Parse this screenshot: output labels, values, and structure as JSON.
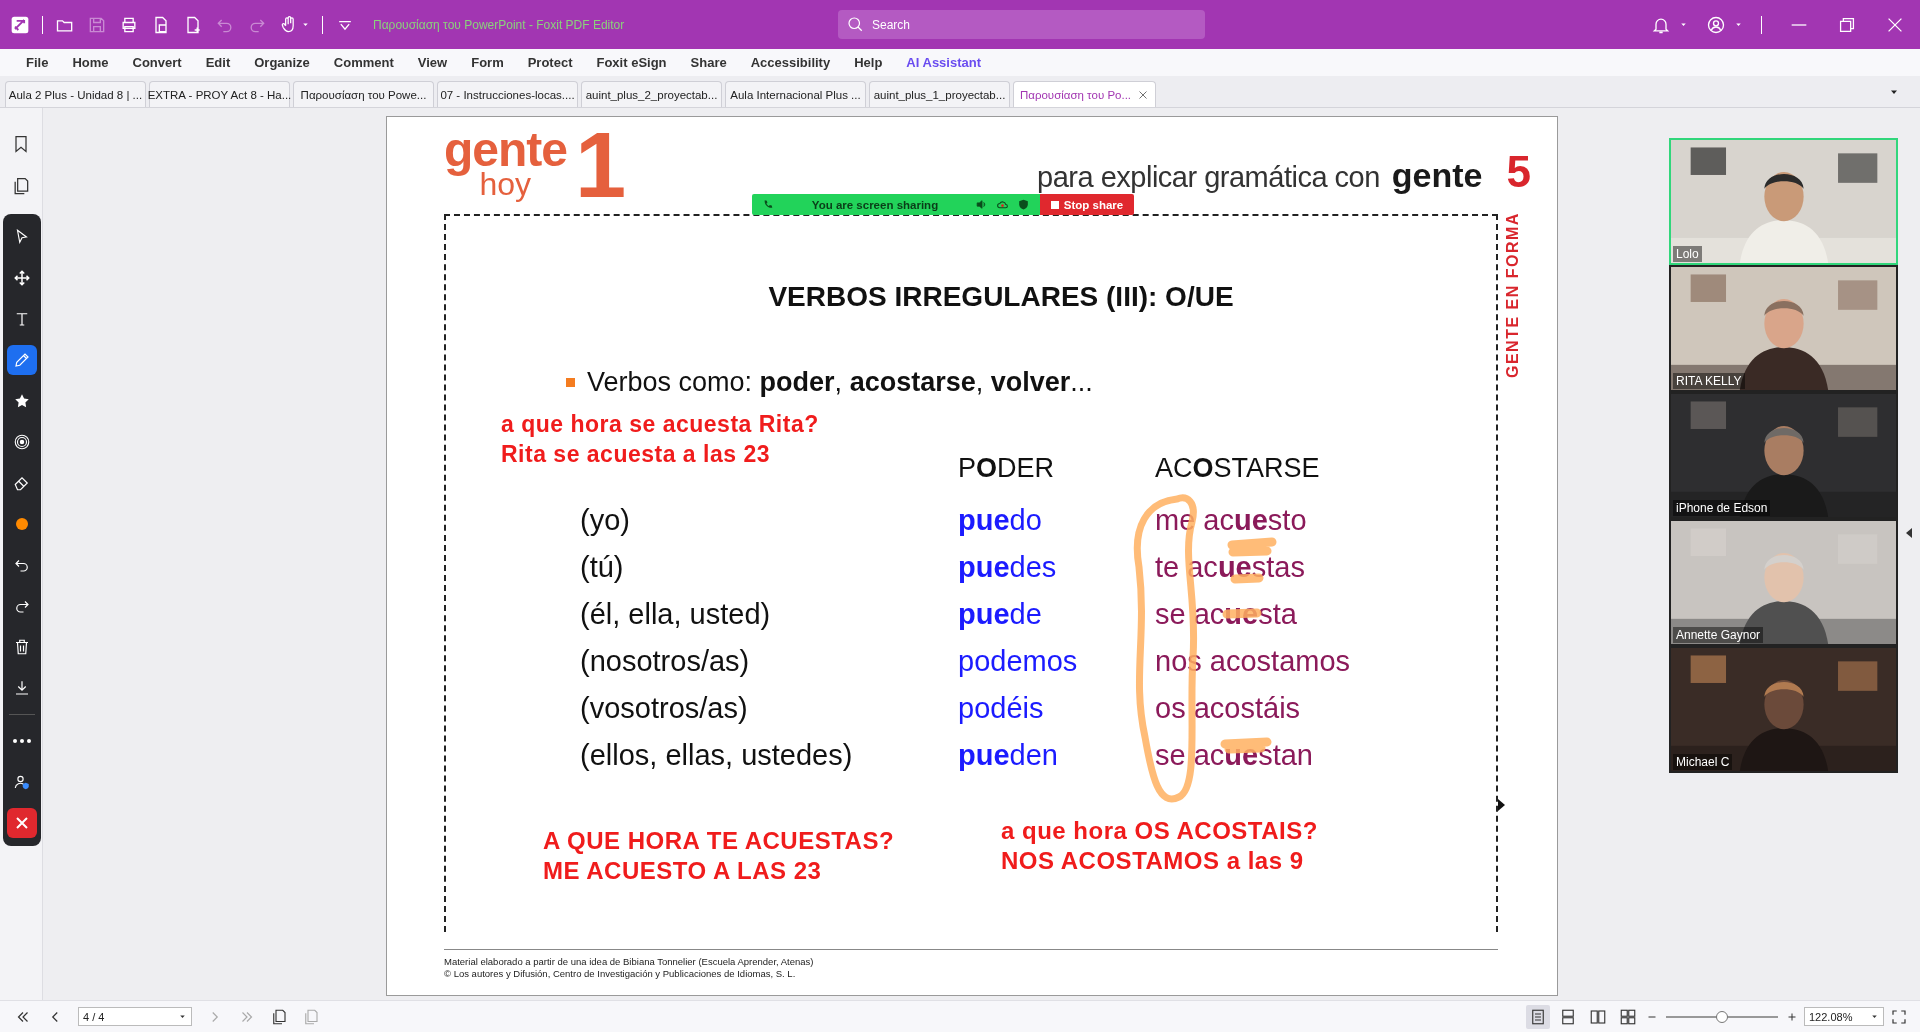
{
  "window": {
    "title": "Παρουσίαση του PowerPoint - Foxit PDF Editor"
  },
  "quick_access": [
    {
      "disabled": false
    },
    {
      "disabled": true
    },
    {
      "disabled": false
    },
    {
      "disabled": false
    },
    {
      "disabled": false
    },
    {
      "disabled": true
    },
    {
      "disabled": true
    },
    {
      "disabled": false
    }
  ],
  "search": {
    "placeholder": "Search"
  },
  "menu": [
    {
      "label": "File",
      "kind": "menu"
    },
    {
      "label": "Home",
      "kind": "menu"
    },
    {
      "label": "Convert",
      "kind": "menu"
    },
    {
      "label": "Edit",
      "kind": "menu"
    },
    {
      "label": "Organize",
      "kind": "menu"
    },
    {
      "label": "Comment",
      "kind": "menu"
    },
    {
      "label": "View",
      "kind": "menu"
    },
    {
      "label": "Form",
      "kind": "menu"
    },
    {
      "label": "Protect",
      "kind": "menu"
    },
    {
      "label": "Foxit eSign",
      "kind": "menu"
    },
    {
      "label": "Share",
      "kind": "menu"
    },
    {
      "label": "Accessibility",
      "kind": "menu"
    },
    {
      "label": "Help",
      "kind": "menu"
    },
    {
      "label": "AI Assistant",
      "kind": "ai"
    }
  ],
  "tabs": [
    {
      "label": "Aula 2 Plus - Unidad 8 | ...",
      "selected": false
    },
    {
      "label": "EXTRA - PROY Act 8 - Ha...",
      "selected": false
    },
    {
      "label": "Παρουσίαση του Powe...",
      "selected": false
    },
    {
      "label": "07 - Instrucciones-locas....",
      "selected": false
    },
    {
      "label": "auint_plus_2_proyectab...",
      "selected": false
    },
    {
      "label": "Aula Internacional Plus ...",
      "selected": false
    },
    {
      "label": "auint_plus_1_proyectab...",
      "selected": false
    },
    {
      "label": "Παρουσίαση του Po...",
      "selected": true
    }
  ],
  "tools": [
    {
      "selected": false
    },
    {
      "selected": false
    },
    {
      "selected": false
    },
    {
      "selected": true
    },
    {
      "selected": false
    },
    {
      "selected": false
    },
    {
      "selected": false
    },
    {
      "selected": false
    },
    {
      "selected": false
    },
    {
      "selected": false
    },
    {
      "selected": false
    },
    {
      "selected": false
    },
    {
      "selected": false
    },
    {
      "selected": false
    }
  ],
  "slide": {
    "logo": {
      "word": "gente",
      "sub": "hoy",
      "number": "1"
    },
    "tagline": {
      "text": "para explicar gramática con",
      "brand": "gente",
      "number": "5"
    },
    "side_label": "GENTE EN FORMA",
    "title": "VERBOS IRREGULARES (III): O/UE",
    "bullet": "Verbos como: **poder**, **acostarse**, **volver**...",
    "note_top": [
      "a que hora se acuesta Rita?",
      "Rita se acuesta a las 23"
    ],
    "columns": [
      "P**O**DER",
      "AC**O**STARSE"
    ],
    "rows": [
      {
        "person": "(yo)",
        "poder": "**pue**do",
        "acostarse": "me ac**ue**sto"
      },
      {
        "person": "(tú)",
        "poder": "**pue**des",
        "acostarse": "te ac**ue**stas"
      },
      {
        "person": "(él, ella, usted)",
        "poder": "**pue**de",
        "acostarse": "se ac**ue**sta"
      },
      {
        "person": "(nosotros/as)",
        "poder": "podemos",
        "acostarse": "nos acostamos"
      },
      {
        "person": "(vosotros/as)",
        "poder": "podéis",
        "acostarse": "os acostáis"
      },
      {
        "person": "(ellos, ellas, ustedes)",
        "poder": "**pue**den",
        "acostarse": "se ac**ue**stan"
      }
    ],
    "notes_bottom": [
      [
        "A QUE HORA TE ACUESTAS?",
        "ME ACUESTO A LAS 23"
      ],
      [
        "a que hora OS ACOSTAIS?",
        "NOS ACOSTAMOS a las 9"
      ]
    ],
    "footer": [
      "Material elaborado a partir de una idea de Bibiana Tonnelier (Escuela Aprender, Atenas)",
      "© Los autores y Difusión, Centro de Investigación y Publicaciones de Idiomas, S. L."
    ]
  },
  "share_bar": {
    "status": "You are screen sharing",
    "stop": "Stop share"
  },
  "participants": [
    {
      "name": "Lolo",
      "speaking": true
    },
    {
      "name": "RITA KELLY",
      "speaking": false
    },
    {
      "name": "iPhone de Edson",
      "speaking": false
    },
    {
      "name": "Annette Gaynor",
      "speaking": false
    },
    {
      "name": "Michael C",
      "speaking": false
    }
  ],
  "status_bar": {
    "page": "4 / 4",
    "view_modes": [
      {
        "selected": true
      },
      {
        "selected": false
      },
      {
        "selected": false
      },
      {
        "selected": false
      }
    ],
    "zoom_slider": {
      "level": 0.5
    },
    "zoom": "122.08%"
  }
}
